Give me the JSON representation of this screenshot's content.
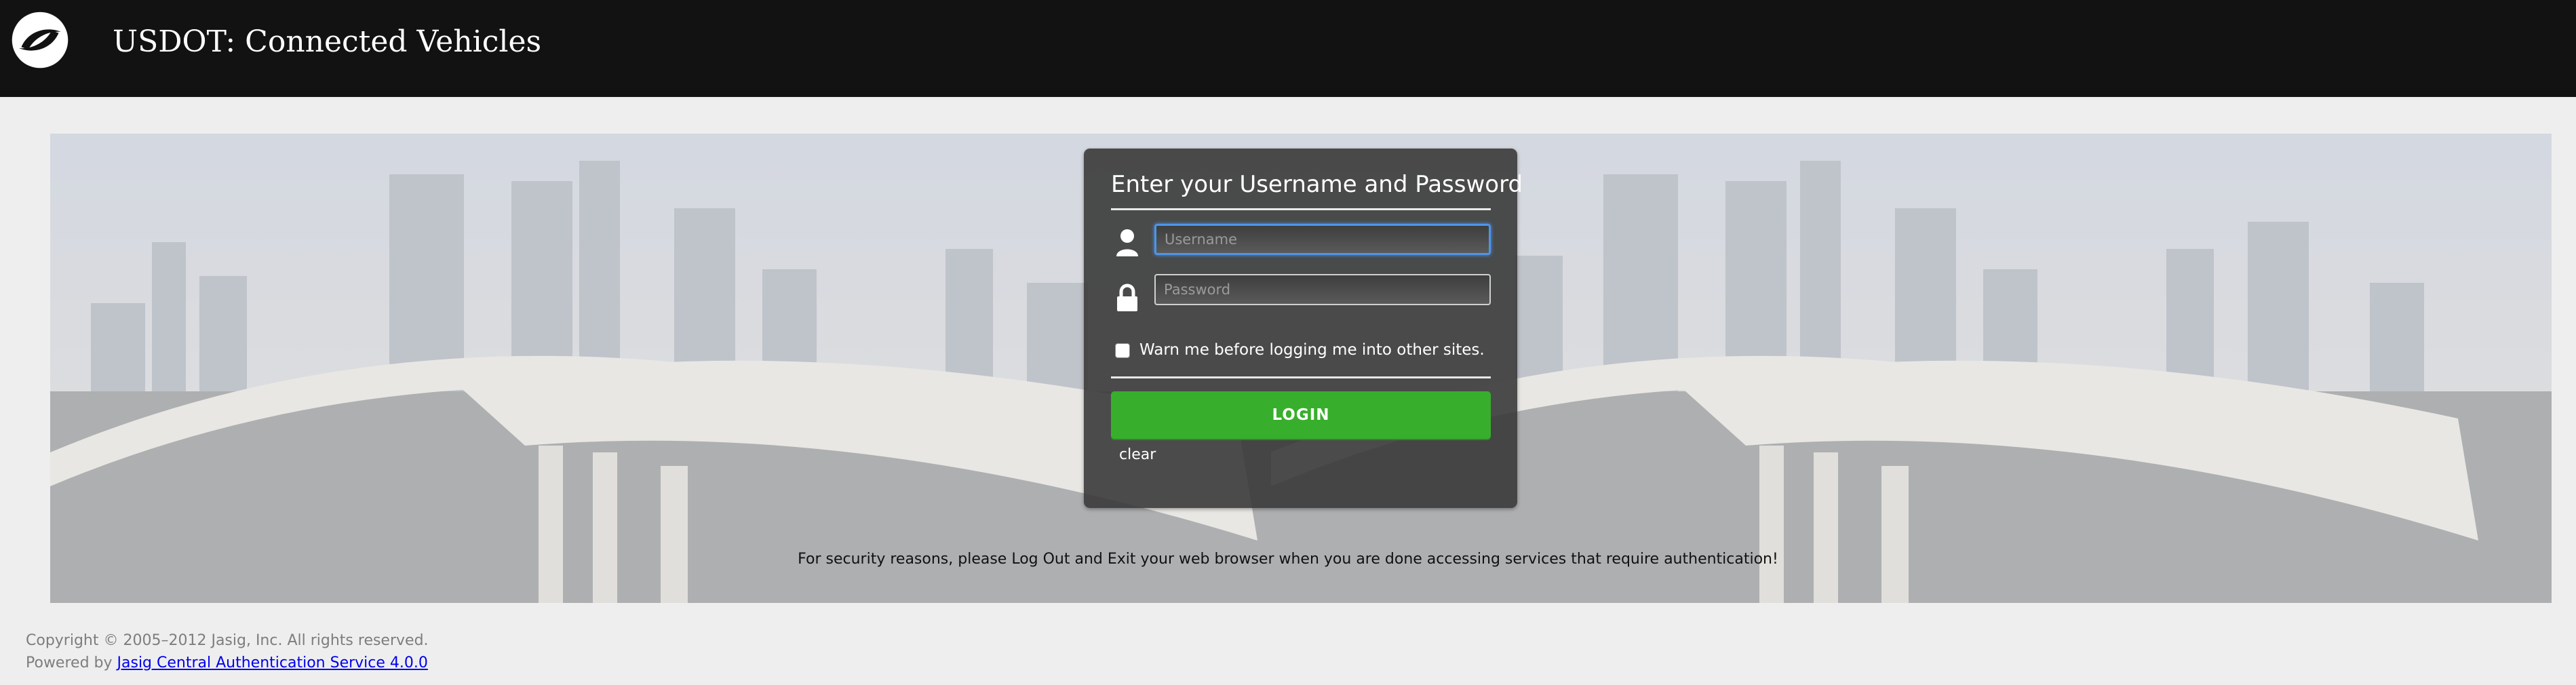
{
  "header": {
    "title": "USDOT: Connected Vehicles",
    "logo_icon": "usdot-logo-icon"
  },
  "login": {
    "heading": "Enter your Username and Password",
    "username_placeholder": "Username",
    "username_value": "",
    "password_placeholder": "Password",
    "password_value": "",
    "user_icon": "user-icon",
    "lock_icon": "lock-icon",
    "warn_checked": false,
    "warn_label": "Warn me before logging me into other sites.",
    "login_button": "LOGIN",
    "clear_link": "clear"
  },
  "notice": "For security reasons, please Log Out and Exit your web browser when you are done accessing services that require authentication!",
  "footer": {
    "copyright": "Copyright © 2005–2012 Jasig, Inc. All rights reserved.",
    "powered_by": "Powered by",
    "cas_link": "Jasig Central Authentication Service 4.0.0"
  },
  "colors": {
    "header_bg": "#121212",
    "page_bg": "#eeeeee",
    "login_button": "#38ae2d",
    "focus_ring": "#4d95e8"
  }
}
